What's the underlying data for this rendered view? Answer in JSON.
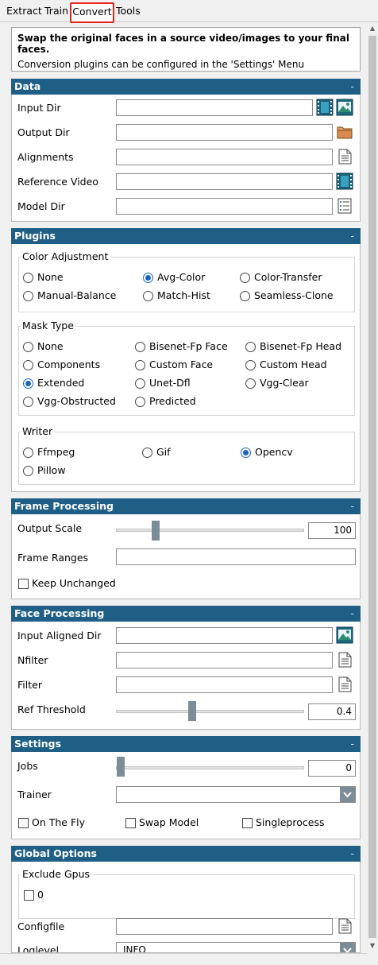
{
  "tabs": [
    {
      "label": "Extract"
    },
    {
      "label": "Train"
    },
    {
      "label": "Convert"
    },
    {
      "label": "Tools"
    }
  ],
  "header": {
    "title": "Swap the original faces in a source video/images to your final faces.",
    "subtitle": "Conversion plugins can be configured in the 'Settings' Menu"
  },
  "sections": {
    "data": {
      "title": "Data",
      "minimize": "-"
    },
    "plugins": {
      "title": "Plugins",
      "minimize": "-"
    },
    "frame": {
      "title": "Frame Processing",
      "minimize": "-"
    },
    "face": {
      "title": "Face Processing",
      "minimize": "-"
    },
    "settings": {
      "title": "Settings",
      "minimize": "-"
    },
    "global": {
      "title": "Global Options",
      "minimize": "-"
    }
  },
  "data": {
    "input_dir": {
      "label": "Input Dir",
      "value": ""
    },
    "output_dir": {
      "label": "Output Dir",
      "value": ""
    },
    "alignments": {
      "label": "Alignments",
      "value": ""
    },
    "reference_video": {
      "label": "Reference Video",
      "value": ""
    },
    "model_dir": {
      "label": "Model Dir",
      "value": ""
    }
  },
  "plugins": {
    "color": {
      "label": "Color Adjustment",
      "options": [
        "None",
        "Avg-Color",
        "Color-Transfer",
        "Manual-Balance",
        "Match-Hist",
        "Seamless-Clone"
      ],
      "selected": "Avg-Color"
    },
    "mask": {
      "label": "Mask Type",
      "options": [
        "None",
        "Bisenet-Fp Face",
        "Bisenet-Fp Head",
        "Components",
        "Custom Face",
        "Custom Head",
        "Extended",
        "Unet-Dfl",
        "Vgg-Clear",
        "Vgg-Obstructed",
        "Predicted"
      ],
      "selected": "Extended"
    },
    "writer": {
      "label": "Writer",
      "options": [
        "Ffmpeg",
        "Gif",
        "Opencv",
        "Pillow"
      ],
      "selected": "Opencv"
    }
  },
  "frame": {
    "output_scale": {
      "label": "Output Scale",
      "value": "100",
      "fraction": 0.2
    },
    "frame_ranges": {
      "label": "Frame Ranges",
      "value": ""
    },
    "keep_unchanged": {
      "label": "Keep Unchanged",
      "checked": false
    }
  },
  "face": {
    "input_aligned_dir": {
      "label": "Input Aligned Dir",
      "value": ""
    },
    "nfilter": {
      "label": "Nfilter",
      "value": ""
    },
    "filter": {
      "label": "Filter",
      "value": ""
    },
    "ref_threshold": {
      "label": "Ref Threshold",
      "value": "0.4",
      "fraction": 0.4
    }
  },
  "settings": {
    "jobs": {
      "label": "Jobs",
      "value": "0",
      "fraction": 0.0
    },
    "trainer": {
      "label": "Trainer",
      "value": ""
    },
    "on_the_fly": {
      "label": "On The Fly",
      "checked": false
    },
    "swap_model": {
      "label": "Swap Model",
      "checked": false
    },
    "singleprocess": {
      "label": "Singleprocess",
      "checked": false
    }
  },
  "global": {
    "exclude_gpus": {
      "label": "Exclude Gpus",
      "options": [
        "0"
      ]
    },
    "configfile": {
      "label": "Configfile",
      "value": ""
    },
    "loglevel": {
      "label": "Loglevel",
      "value": "INFO"
    }
  },
  "scroll": {
    "up": "▲",
    "down": "▼"
  },
  "colors": {
    "section_header": "#1f5f85",
    "radio_selected": "#1a63c3",
    "slider_thumb": "#7c8d97",
    "active_tab_outline": "#e8231c"
  },
  "icons": [
    "video-icon",
    "image-icon",
    "folder-icon",
    "document-icon",
    "list-icon",
    "chevron-down-icon"
  ]
}
